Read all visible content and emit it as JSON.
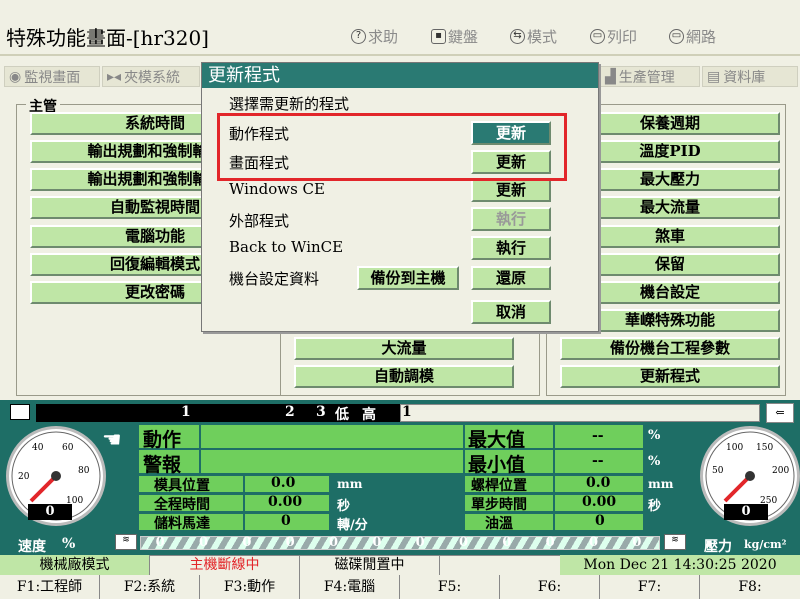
{
  "header": {
    "title": "特殊功能畫面-[hr320]",
    "buttons": [
      {
        "label": "求助",
        "icon": "help-icon",
        "glyph": "?"
      },
      {
        "label": "鍵盤",
        "icon": "keyboard-icon",
        "glyph": "▪"
      },
      {
        "label": "模式",
        "icon": "mode-icon",
        "glyph": "⇆"
      },
      {
        "label": "列印",
        "icon": "printer-icon",
        "glyph": "▭"
      },
      {
        "label": "網路",
        "icon": "network-icon",
        "glyph": "▭"
      }
    ]
  },
  "tabs": [
    {
      "label": "監視畫面",
      "icon": "eye-icon"
    },
    {
      "label": "夾模系統",
      "icon": "clamp-icon"
    },
    {
      "label": "生產管理",
      "icon": "factory-icon"
    },
    {
      "label": "資料庫",
      "icon": "book-icon"
    }
  ],
  "left_group": {
    "legend": "主管",
    "items": [
      "系統時間",
      "輸出規劃和強制輸出",
      "輸出規劃和強制輸出",
      "自動監視時間",
      "電腦功能",
      "回復編輯模式",
      "更改密碼"
    ]
  },
  "mid_group": {
    "items": [
      "大流量",
      "自動調模"
    ]
  },
  "right_group": {
    "items": [
      "保養週期",
      "溫度PID",
      "最大壓力",
      "最大流量",
      "煞車",
      "保留",
      "機台設定",
      "華嶸特殊功能",
      "備份機台工程參數",
      "更新程式"
    ]
  },
  "dialog": {
    "title": "更新程式",
    "subtitle": "選擇需更新的程式",
    "rows": [
      {
        "label": "動作程式",
        "button": "更新",
        "primary": true
      },
      {
        "label": "畫面程式",
        "button": "更新"
      },
      {
        "label": "Windows CE",
        "button": "更新"
      },
      {
        "label": "外部程式",
        "button": "執行",
        "disabled": true
      },
      {
        "label": "Back to WinCE",
        "button": "執行"
      },
      {
        "label": "機台設定資料",
        "button": "還原",
        "extra": "備份到主機"
      }
    ],
    "cancel": "取消"
  },
  "status_strip": {
    "seg1": "1",
    "seg2": "2",
    "seg3": "3",
    "seg4": "低",
    "seg5": "高",
    "seg6": "1"
  },
  "monitor": {
    "action_label": "動作",
    "alarm_label": "警報",
    "max_label": "最大值",
    "max_value": "--",
    "max_unit": "%",
    "min_label": "最小值",
    "min_value": "--",
    "min_unit": "%",
    "rows": [
      {
        "label": "模具位置",
        "value": "0.0",
        "unit": "mm",
        "label2": "螺桿位置",
        "value2": "0.0",
        "unit2": "mm"
      },
      {
        "label": "全程時間",
        "value": "0.00",
        "unit": "秒",
        "label2": "單步時間",
        "value2": "0.00",
        "unit2": "秒"
      },
      {
        "label": "儲料馬達",
        "value": "0",
        "unit": "轉/分",
        "label2": "油溫",
        "value2": "0",
        "unit2": ""
      }
    ],
    "speed_label": "速度",
    "speed_unit": "%",
    "pressure_label": "壓力",
    "pressure_unit": "kg/cm²",
    "speed_gauge": {
      "ticks": [
        "20",
        "40",
        "60",
        "80",
        "100"
      ],
      "value": "0"
    },
    "pressure_gauge": {
      "ticks": [
        "50",
        "100",
        "150",
        "200",
        "250"
      ],
      "value": "0"
    },
    "bar_values": [
      "0",
      "0",
      "0",
      "0",
      "0",
      "0",
      "0",
      "0",
      "0",
      "0",
      "0",
      "0"
    ]
  },
  "status_bar": {
    "mode": "機械廠模式",
    "host": "主機斷線中",
    "disk": "磁碟閒置中",
    "datetime": "Mon Dec 21 14:30:25 2020",
    "host_color": "#e2262a"
  },
  "fkeys": [
    "F1:工程師",
    "F2:系統",
    "F3:動作",
    "F4:電腦",
    "F5:",
    "F6:",
    "F7:",
    "F8:"
  ]
}
